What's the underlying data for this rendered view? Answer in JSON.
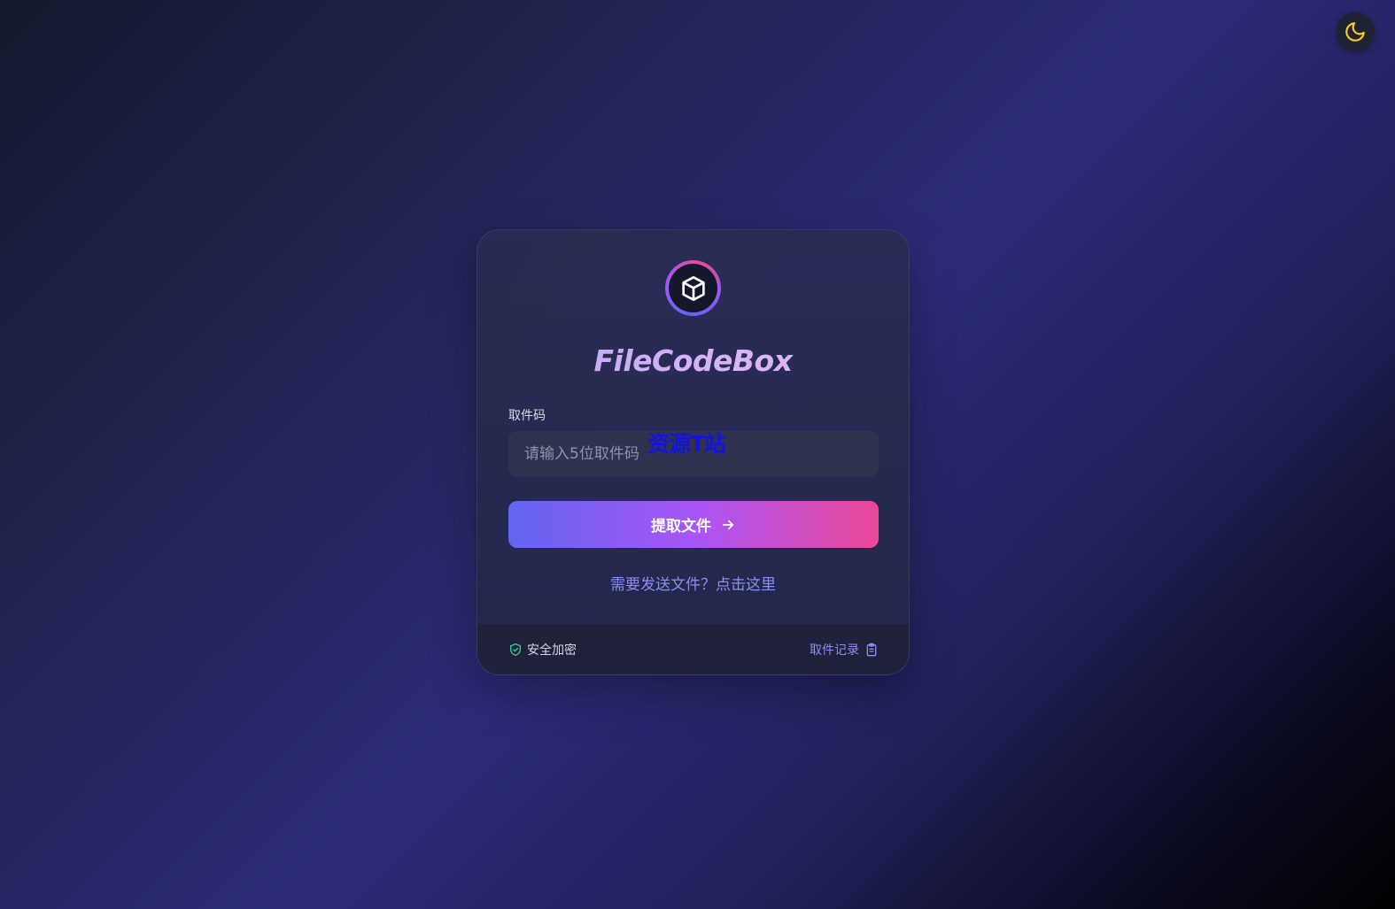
{
  "theme_toggle": {
    "icon": "moon-icon"
  },
  "logo": {
    "icon": "cube-icon"
  },
  "app": {
    "title": "FileCodeBox"
  },
  "form": {
    "code_label": "取件码",
    "code_placeholder": "请输入5位取件码",
    "code_value": "",
    "submit_label": "提取文件",
    "submit_icon": "arrow-right-icon",
    "send_link": "需要发送文件？点击这里"
  },
  "watermark": {
    "text": "资源T站"
  },
  "footer": {
    "secure_label": "安全加密",
    "secure_icon": "shield-check-icon",
    "history_label": "取件记录",
    "history_icon": "clipboard-icon"
  },
  "colors": {
    "accent_start": "#6366f1",
    "accent_mid": "#a855f7",
    "accent_end": "#ec4899",
    "link": "#8b8ff0",
    "moon": "#facc15",
    "secure_icon": "#34d399"
  }
}
